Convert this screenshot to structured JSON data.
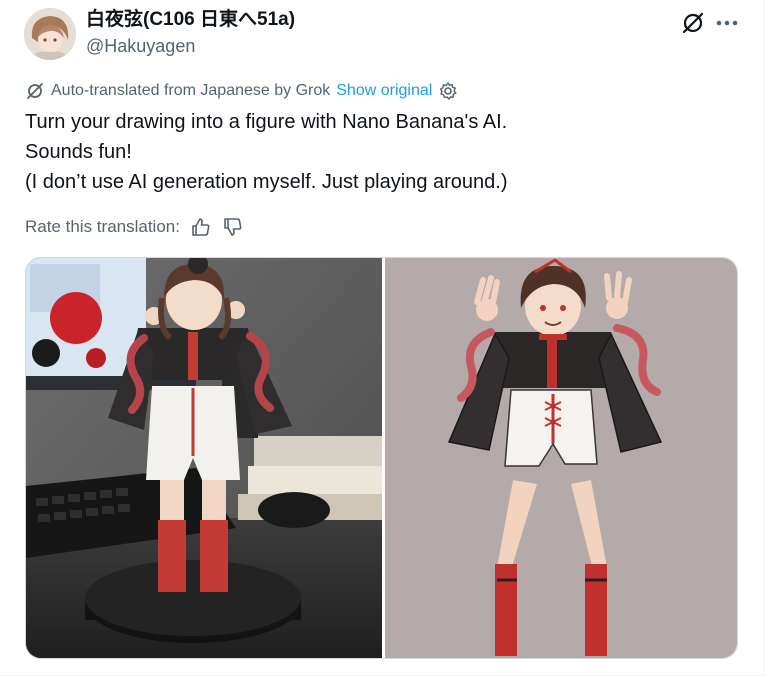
{
  "author": {
    "display_name": "白夜弦(C106 日東へ51a)",
    "handle": "@Hakuyagen",
    "avatar_icon": "avatar-icon"
  },
  "actions": {
    "grok_icon": "grok-icon",
    "more_icon": "more-dots-icon"
  },
  "translation": {
    "notice": "Auto-translated from Japanese by Grok",
    "show_original": "Show original",
    "settings_icon": "gear-icon",
    "rate_label": "Rate this translation:",
    "thumbs_up_icon": "thumbs-up-icon",
    "thumbs_down_icon": "thumbs-down-icon"
  },
  "tweet": {
    "lines": [
      "Turn your drawing into a figure with Nano Banana's AI.",
      "Sounds fun!",
      "(I don’t use AI generation myself. Just playing around.)"
    ]
  },
  "media": {
    "left_image": "photo of painted anime figure on desk",
    "right_image": "original character drawing"
  },
  "colors": {
    "text": "#0f1419",
    "secondary": "#536471",
    "link": "#1d9bf0"
  }
}
